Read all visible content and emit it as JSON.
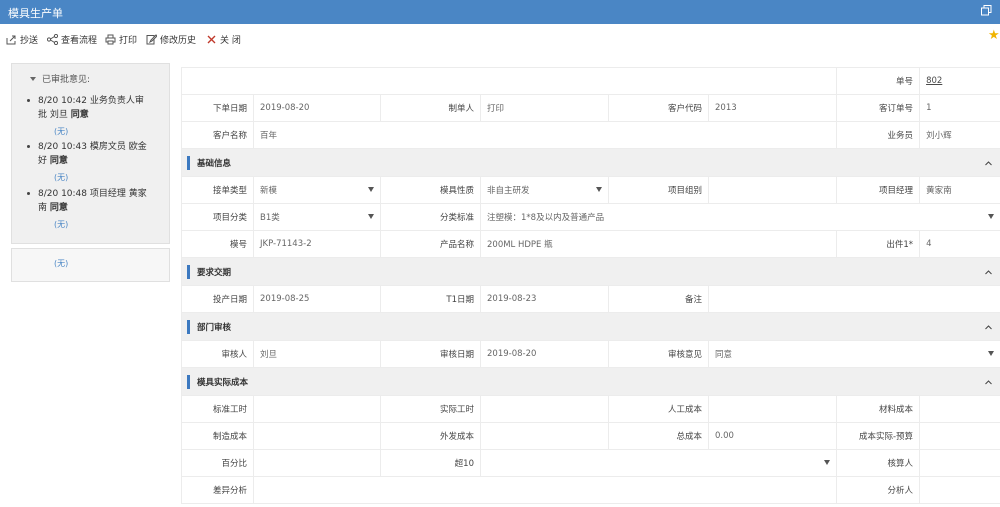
{
  "window": {
    "title": "模具生产单"
  },
  "toolbar": [
    {
      "name": "cc-button",
      "icon": "share-icon",
      "label": "抄送"
    },
    {
      "name": "view-flow-button",
      "icon": "flow-icon",
      "label": "查看流程"
    },
    {
      "name": "print-button",
      "icon": "printer-icon",
      "label": "打印"
    },
    {
      "name": "history-button",
      "icon": "edit-history-icon",
      "label": "修改历史"
    },
    {
      "name": "close-button",
      "icon": "close-icon",
      "label": "关 闭"
    }
  ],
  "approvals": {
    "header": "已审批意见:",
    "items": [
      {
        "line1": "8/20 10:42 业务负责人审",
        "line2": "批 刘旦 ",
        "result": "同意",
        "comment": "(无)"
      },
      {
        "line1": "8/20 10:43 模房文员 欧金",
        "line2": "好 ",
        "result": "同意",
        "comment": "(无)"
      },
      {
        "line1": "8/20 10:48 项目经理 黄家",
        "line2": "南 ",
        "result": "同意",
        "comment": "(无)"
      }
    ],
    "extra_comment": "(无)"
  },
  "form": {
    "order_no_label": "单号",
    "order_no": "802",
    "order_date_label": "下单日期",
    "order_date": "2019-08-20",
    "maker_label": "制单人",
    "maker": "打印",
    "customer_code_label": "客户代码",
    "customer_code": "2013",
    "customer_order_label": "客订单号",
    "customer_order": "1",
    "customer_name_label": "客户名称",
    "customer_name": "百年",
    "salesman_label": "业务员",
    "salesman": "刘小辉",
    "sec_basic": "基础信息",
    "order_type_label": "接单类型",
    "order_type": "新模",
    "mold_nature_label": "模具性质",
    "mold_nature": "非自主研发",
    "project_group_label": "项目组别",
    "project_group": "",
    "project_manager_label": "项目经理",
    "project_manager": "黄家南",
    "project_class_label": "项目分类",
    "project_class": "B1类",
    "class_standard_label": "分类标准",
    "class_standard": "注塑模：1*8及以内及普通产品",
    "mold_no_label": "模号",
    "mold_no": "JKP-71143-2",
    "product_name_label": "产品名称",
    "product_name": "200ML HDPE 瓶",
    "output_label": "出件1*",
    "output": "4",
    "sec_delivery": "要求交期",
    "start_date_label": "投产日期",
    "start_date": "2019-08-25",
    "t1_date_label": "T1日期",
    "t1_date": "2019-08-23",
    "remark_label": "备注",
    "remark": "",
    "sec_review": "部门审核",
    "reviewer_label": "审核人",
    "reviewer": "刘旦",
    "review_date_label": "审核日期",
    "review_date": "2019-08-20",
    "review_opinion_label": "审核意见",
    "review_opinion": "同意",
    "sec_cost": "模具实际成本",
    "std_hours_label": "标准工时",
    "act_hours_label": "实际工时",
    "labor_cost_label": "人工成本",
    "material_cost_label": "材料成本",
    "mfg_cost_label": "制造成本",
    "outsource_cost_label": "外发成本",
    "total_cost_label": "总成本",
    "total_cost": "0.00",
    "cost_diff_label": "成本实际-预算",
    "percent_label": "百分比",
    "over10_label": "超10",
    "accountant_label": "核算人",
    "diff_analysis_label": "差异分析",
    "analyst_label": "分析人"
  },
  "colors": {
    "titlebar": "#4a86c5",
    "section_bar": "#3c79c0",
    "star": "#f0b400"
  }
}
